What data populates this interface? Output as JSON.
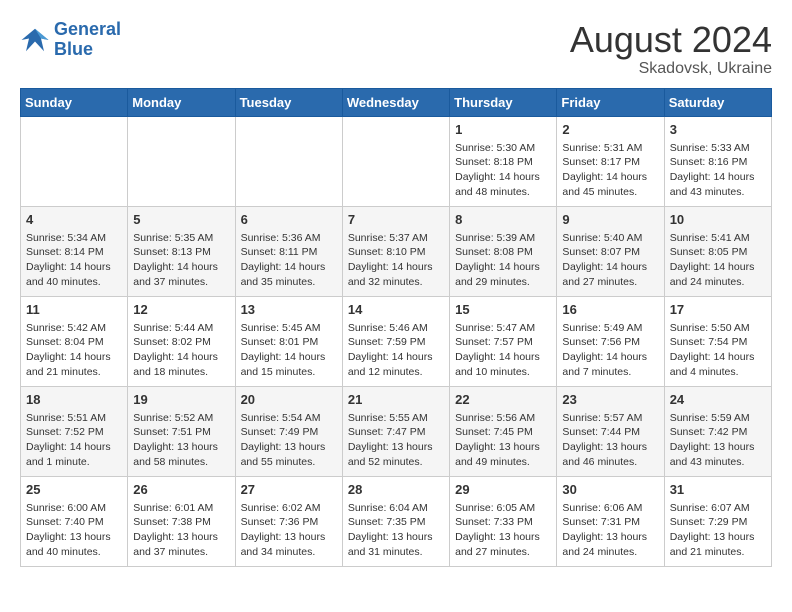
{
  "logo": {
    "general": "General",
    "blue": "Blue"
  },
  "title": "August 2024",
  "subtitle": "Skadovsk, Ukraine",
  "days_header": [
    "Sunday",
    "Monday",
    "Tuesday",
    "Wednesday",
    "Thursday",
    "Friday",
    "Saturday"
  ],
  "weeks": [
    [
      {
        "day": "",
        "info": ""
      },
      {
        "day": "",
        "info": ""
      },
      {
        "day": "",
        "info": ""
      },
      {
        "day": "",
        "info": ""
      },
      {
        "day": "1",
        "info": "Sunrise: 5:30 AM\nSunset: 8:18 PM\nDaylight: 14 hours\nand 48 minutes."
      },
      {
        "day": "2",
        "info": "Sunrise: 5:31 AM\nSunset: 8:17 PM\nDaylight: 14 hours\nand 45 minutes."
      },
      {
        "day": "3",
        "info": "Sunrise: 5:33 AM\nSunset: 8:16 PM\nDaylight: 14 hours\nand 43 minutes."
      }
    ],
    [
      {
        "day": "4",
        "info": "Sunrise: 5:34 AM\nSunset: 8:14 PM\nDaylight: 14 hours\nand 40 minutes."
      },
      {
        "day": "5",
        "info": "Sunrise: 5:35 AM\nSunset: 8:13 PM\nDaylight: 14 hours\nand 37 minutes."
      },
      {
        "day": "6",
        "info": "Sunrise: 5:36 AM\nSunset: 8:11 PM\nDaylight: 14 hours\nand 35 minutes."
      },
      {
        "day": "7",
        "info": "Sunrise: 5:37 AM\nSunset: 8:10 PM\nDaylight: 14 hours\nand 32 minutes."
      },
      {
        "day": "8",
        "info": "Sunrise: 5:39 AM\nSunset: 8:08 PM\nDaylight: 14 hours\nand 29 minutes."
      },
      {
        "day": "9",
        "info": "Sunrise: 5:40 AM\nSunset: 8:07 PM\nDaylight: 14 hours\nand 27 minutes."
      },
      {
        "day": "10",
        "info": "Sunrise: 5:41 AM\nSunset: 8:05 PM\nDaylight: 14 hours\nand 24 minutes."
      }
    ],
    [
      {
        "day": "11",
        "info": "Sunrise: 5:42 AM\nSunset: 8:04 PM\nDaylight: 14 hours\nand 21 minutes."
      },
      {
        "day": "12",
        "info": "Sunrise: 5:44 AM\nSunset: 8:02 PM\nDaylight: 14 hours\nand 18 minutes."
      },
      {
        "day": "13",
        "info": "Sunrise: 5:45 AM\nSunset: 8:01 PM\nDaylight: 14 hours\nand 15 minutes."
      },
      {
        "day": "14",
        "info": "Sunrise: 5:46 AM\nSunset: 7:59 PM\nDaylight: 14 hours\nand 12 minutes."
      },
      {
        "day": "15",
        "info": "Sunrise: 5:47 AM\nSunset: 7:57 PM\nDaylight: 14 hours\nand 10 minutes."
      },
      {
        "day": "16",
        "info": "Sunrise: 5:49 AM\nSunset: 7:56 PM\nDaylight: 14 hours\nand 7 minutes."
      },
      {
        "day": "17",
        "info": "Sunrise: 5:50 AM\nSunset: 7:54 PM\nDaylight: 14 hours\nand 4 minutes."
      }
    ],
    [
      {
        "day": "18",
        "info": "Sunrise: 5:51 AM\nSunset: 7:52 PM\nDaylight: 14 hours\nand 1 minute."
      },
      {
        "day": "19",
        "info": "Sunrise: 5:52 AM\nSunset: 7:51 PM\nDaylight: 13 hours\nand 58 minutes."
      },
      {
        "day": "20",
        "info": "Sunrise: 5:54 AM\nSunset: 7:49 PM\nDaylight: 13 hours\nand 55 minutes."
      },
      {
        "day": "21",
        "info": "Sunrise: 5:55 AM\nSunset: 7:47 PM\nDaylight: 13 hours\nand 52 minutes."
      },
      {
        "day": "22",
        "info": "Sunrise: 5:56 AM\nSunset: 7:45 PM\nDaylight: 13 hours\nand 49 minutes."
      },
      {
        "day": "23",
        "info": "Sunrise: 5:57 AM\nSunset: 7:44 PM\nDaylight: 13 hours\nand 46 minutes."
      },
      {
        "day": "24",
        "info": "Sunrise: 5:59 AM\nSunset: 7:42 PM\nDaylight: 13 hours\nand 43 minutes."
      }
    ],
    [
      {
        "day": "25",
        "info": "Sunrise: 6:00 AM\nSunset: 7:40 PM\nDaylight: 13 hours\nand 40 minutes."
      },
      {
        "day": "26",
        "info": "Sunrise: 6:01 AM\nSunset: 7:38 PM\nDaylight: 13 hours\nand 37 minutes."
      },
      {
        "day": "27",
        "info": "Sunrise: 6:02 AM\nSunset: 7:36 PM\nDaylight: 13 hours\nand 34 minutes."
      },
      {
        "day": "28",
        "info": "Sunrise: 6:04 AM\nSunset: 7:35 PM\nDaylight: 13 hours\nand 31 minutes."
      },
      {
        "day": "29",
        "info": "Sunrise: 6:05 AM\nSunset: 7:33 PM\nDaylight: 13 hours\nand 27 minutes."
      },
      {
        "day": "30",
        "info": "Sunrise: 6:06 AM\nSunset: 7:31 PM\nDaylight: 13 hours\nand 24 minutes."
      },
      {
        "day": "31",
        "info": "Sunrise: 6:07 AM\nSunset: 7:29 PM\nDaylight: 13 hours\nand 21 minutes."
      }
    ]
  ]
}
